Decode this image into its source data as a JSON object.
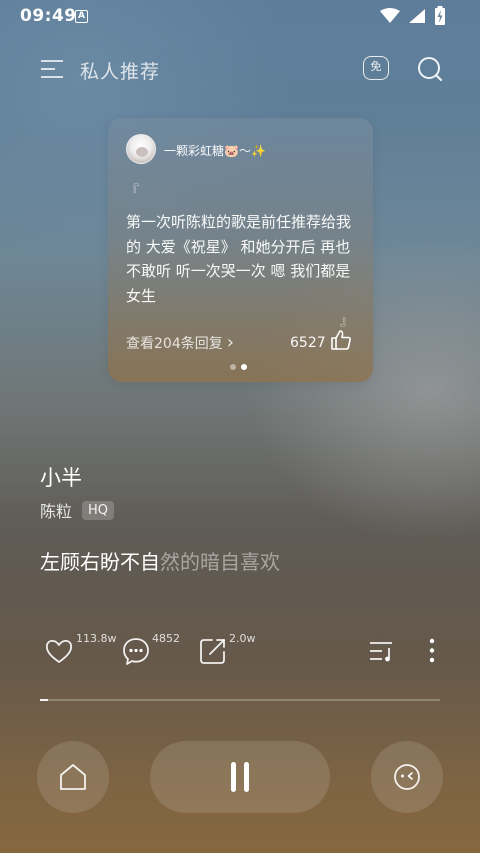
{
  "status_bar": {
    "time": "09:49",
    "notification_letter": "A"
  },
  "header": {
    "title": "私人推荐",
    "free_badge": "免"
  },
  "comment_card": {
    "username": "一颗彩虹糖🐷～✨",
    "quote_open": "『",
    "quote_close": "』",
    "text": "第一次听陈粒的歌是前任推荐给我的 大爱《祝星》 和她分开后 再也不敢听 听一次哭一次 嗯 我们都是女生",
    "replies_label": "查看204条回复",
    "replies_chevron": "›",
    "like_count": "6527",
    "pager": {
      "count": 2,
      "active_index": 1
    }
  },
  "song": {
    "title": "小半",
    "artist": "陈粒",
    "quality_badge": "HQ",
    "lyric_sung": "左顾右盼不自",
    "lyric_unsung": "然的暗自喜欢"
  },
  "actions": {
    "like_count": "113.8w",
    "comment_count": "4852",
    "share_count": "2.0w"
  },
  "playback": {
    "progress_fraction": 0.02,
    "state": "playing"
  },
  "icons": [
    "menu-icon",
    "free-icon",
    "search-icon",
    "like-thumb-icon",
    "heart-icon",
    "comment-icon",
    "share-icon",
    "playlist-icon",
    "more-icon",
    "home-icon",
    "pause-icon",
    "mood-icon",
    "wifi-icon",
    "signal-icon",
    "battery-icon"
  ],
  "colors": {
    "text": "#ffffff",
    "background_top": "#5d7d9a",
    "background_bottom": "#86683f"
  }
}
